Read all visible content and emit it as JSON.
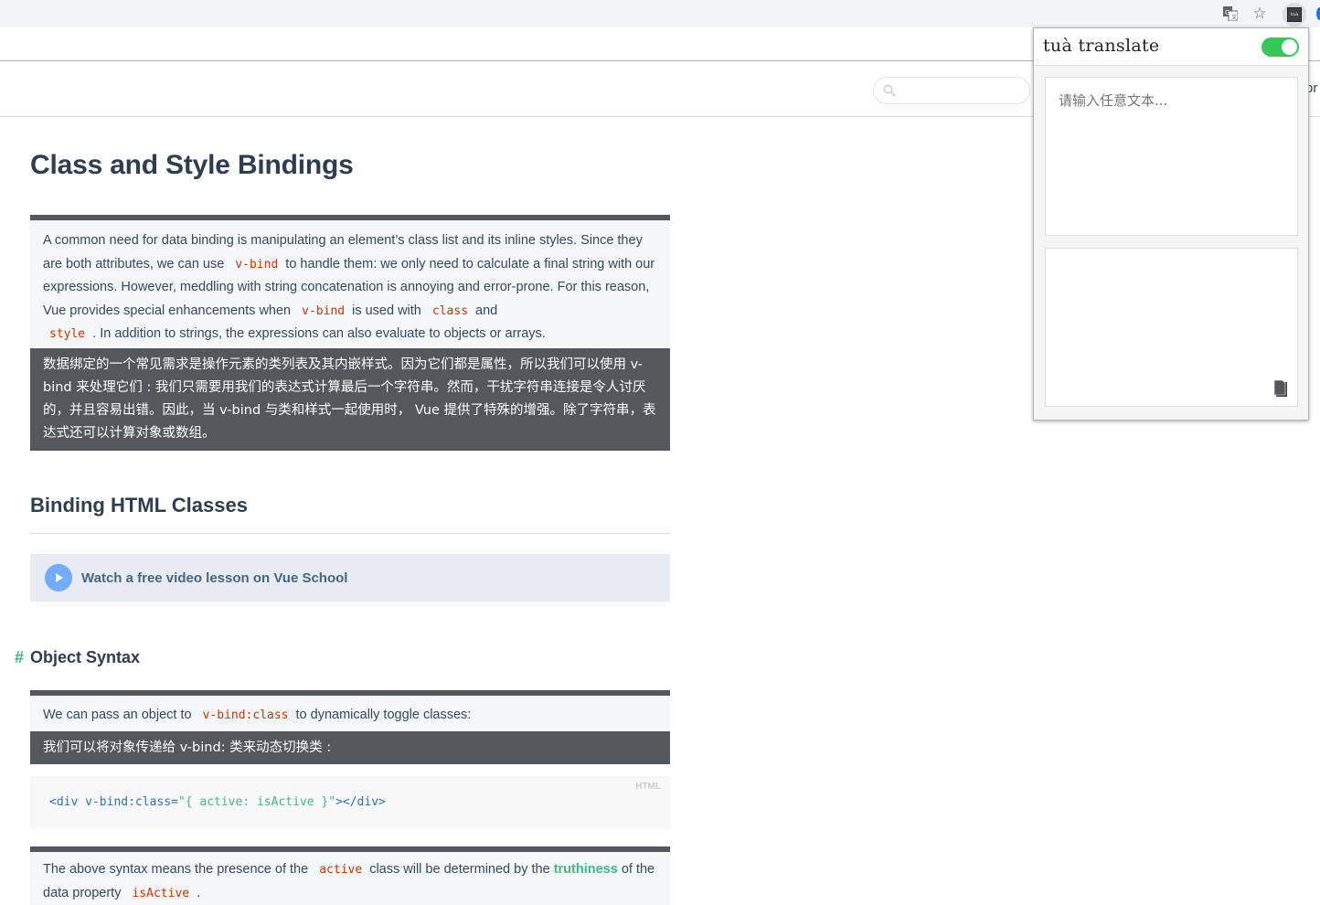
{
  "browser": {
    "toolbar_icons": [
      "translate-icon",
      "star-icon",
      "tua-extension-icon"
    ],
    "extension_logo_text": "tuà"
  },
  "site": {
    "search_placeholder": "",
    "nav_partial": "or"
  },
  "page": {
    "title": "Class and Style Bindings",
    "intro": {
      "original_parts": [
        "A common need for data binding is manipulating an element’s class list and its inline styles. Since they are both attributes, we can use",
        "v-bind",
        "to handle them: we only need to calculate a final string with our expressions. However, meddling with string concatenation is annoying and error-prone. For this reason, Vue provides special enhancements when",
        "v-bind",
        "is used with",
        "class",
        "and",
        "style",
        ". In addition to strings, the expressions can also evaluate to objects or arrays."
      ],
      "translation": "数据绑定的一个常见需求是操作元素的类列表及其内嵌样式。因为它们都是属性，所以我们可以使用 v-bind 来处理它们 : 我们只需要用我们的表达式计算最后一个字符串。然而，干扰字符串连接是令人讨厌的，并且容易出错。因此，当 v-bind 与类和样式一起使用时， Vue 提供了特殊的增强。除了字符串，表达式还可以计算对象或数组。"
    },
    "section_heading": "Binding HTML Classes",
    "video_link": "Watch a free video lesson on Vue School",
    "subsection": {
      "anchor": "#",
      "heading": "Object Syntax"
    },
    "object_syntax": {
      "original_parts": [
        "We can pass an object to",
        "v-bind:class",
        "to dynamically toggle classes:"
      ],
      "translation": "我们可以将对象传递给 v-bind: 类来动态切换类 :"
    },
    "code": {
      "language": "HTML",
      "prefix": "<div v-bind:class=",
      "string": "\"{ active: isActive }\"",
      "suffix": "></div>"
    },
    "explanation": {
      "parts": [
        "The above syntax means the presence of the",
        "active",
        "class will be determined by the",
        "truthiness",
        "of the data property",
        "isActive",
        "."
      ]
    }
  },
  "popup": {
    "title": "tuà translate",
    "enabled": true,
    "input_placeholder": "请输入任意文本...",
    "input_value": "",
    "output_value": "",
    "accent_color": "#34c759"
  }
}
